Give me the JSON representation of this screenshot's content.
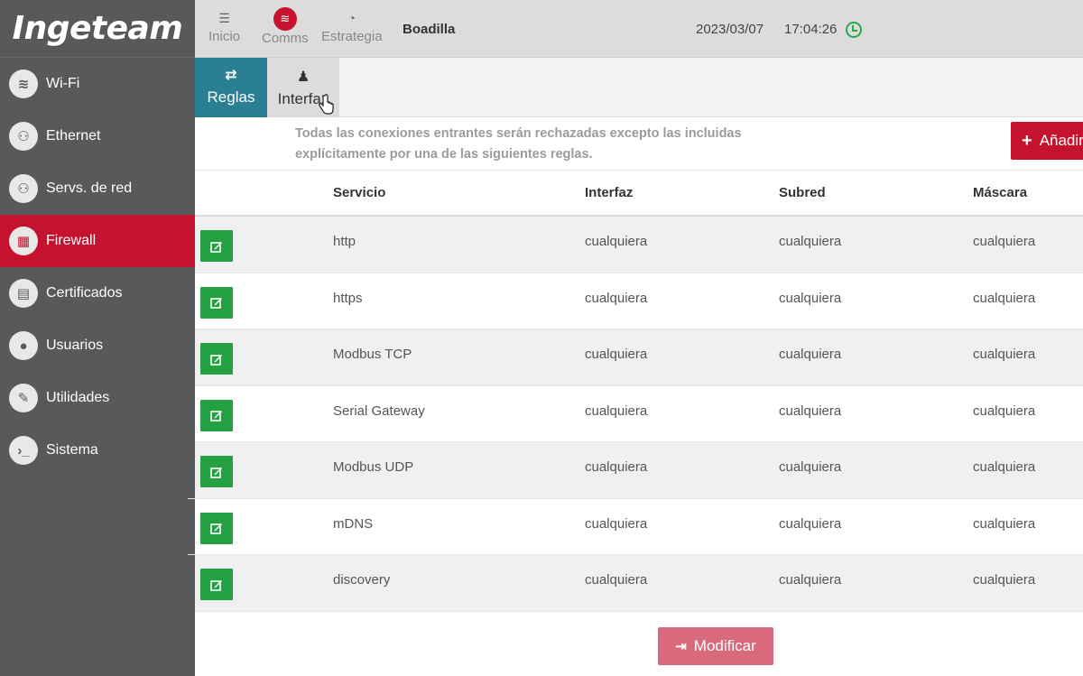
{
  "brand": {
    "logo_text": "Ingeteam"
  },
  "sidebar": {
    "items": [
      {
        "label": "Wi-Fi",
        "icon": "wifi-icon",
        "glyph": "≋",
        "active": false
      },
      {
        "label": "Ethernet",
        "icon": "network-icon",
        "glyph": "⚇",
        "active": false
      },
      {
        "label": "Servs. de red",
        "icon": "network-services-icon",
        "glyph": "⚇",
        "active": false
      },
      {
        "label": "Firewall",
        "icon": "grid-icon",
        "glyph": "▦",
        "active": true
      },
      {
        "label": "Certificados",
        "icon": "document-icon",
        "glyph": "▤",
        "active": false
      },
      {
        "label": "Usuarios",
        "icon": "user-icon",
        "glyph": "●",
        "active": false
      },
      {
        "label": "Utilidades",
        "icon": "wrench-icon",
        "glyph": "✎",
        "active": false
      },
      {
        "label": "Sistema",
        "icon": "terminal-icon",
        "glyph": "›_",
        "active": false
      }
    ]
  },
  "topbar": {
    "items": [
      {
        "label": "Inicio",
        "icon": "server-icon",
        "glyph": "☰"
      },
      {
        "label": "Comms",
        "icon": "wifi-icon",
        "glyph": "≋"
      },
      {
        "label": "Estrategia",
        "icon": "dashboard-icon",
        "glyph": "◔"
      }
    ],
    "site_name": "Boadilla",
    "date": "2023/03/07",
    "time": "17:04:26",
    "status_color": "#2aa84a"
  },
  "tabs": [
    {
      "label": "Reglas",
      "icon": "exchange-icon",
      "glyph": "⇄",
      "active": true
    },
    {
      "label": "Interfaz",
      "icon": "sitemap-icon",
      "glyph": "♟",
      "active": false
    }
  ],
  "notice": {
    "line1": "Todas las conexiones entrantes serán rechazadas excepto las incluidas",
    "line2": "explícitamente por una de las siguientes reglas."
  },
  "add_button_label": "Añadir",
  "table": {
    "headers": {
      "service": "Servicio",
      "interface": "Interfaz",
      "subnet": "Subred",
      "mask": "Máscara"
    },
    "rows": [
      {
        "service": "http",
        "interface": "cualquiera",
        "subnet": "cualquiera",
        "mask": "cualquiera"
      },
      {
        "service": "https",
        "interface": "cualquiera",
        "subnet": "cualquiera",
        "mask": "cualquiera"
      },
      {
        "service": "Modbus TCP",
        "interface": "cualquiera",
        "subnet": "cualquiera",
        "mask": "cualquiera"
      },
      {
        "service": "Serial Gateway",
        "interface": "cualquiera",
        "subnet": "cualquiera",
        "mask": "cualquiera"
      },
      {
        "service": "Modbus UDP",
        "interface": "cualquiera",
        "subnet": "cualquiera",
        "mask": "cualquiera"
      },
      {
        "service": "mDNS",
        "interface": "cualquiera",
        "subnet": "cualquiera",
        "mask": "cualquiera"
      },
      {
        "service": "discovery",
        "interface": "cualquiera",
        "subnet": "cualquiera",
        "mask": "cualquiera"
      }
    ]
  },
  "modify_button_label": "Modificar",
  "colors": {
    "brand_red": "#c4122f",
    "tab_teal": "#2a7f93",
    "edit_green": "#23a142",
    "sidebar_gray": "#58595b"
  }
}
